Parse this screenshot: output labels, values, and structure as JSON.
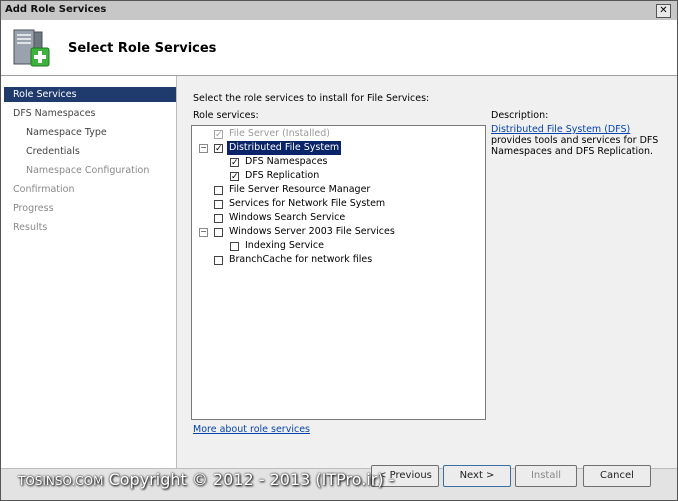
{
  "window": {
    "title": "Add Role Services",
    "close_glyph": "✕"
  },
  "header": {
    "heading": "Select Role Services",
    "icon": "server-add-icon"
  },
  "nav": {
    "items": [
      {
        "label": "Role Services",
        "state": "active"
      },
      {
        "label": "DFS Namespaces",
        "state": "normal"
      },
      {
        "label": "Namespace Type",
        "state": "sub"
      },
      {
        "label": "Credentials",
        "state": "sub"
      },
      {
        "label": "Namespace Configuration",
        "state": "sub-dim"
      },
      {
        "label": "Confirmation",
        "state": "dim"
      },
      {
        "label": "Progress",
        "state": "dim"
      },
      {
        "label": "Results",
        "state": "dim"
      }
    ]
  },
  "content": {
    "instruction": "Select the role services to install for File Services:",
    "role_services_label": "Role services:",
    "tree": [
      {
        "label": "File Server  (Installed)",
        "checked": true,
        "disabled": true
      },
      {
        "label": "Distributed File System",
        "checked": true,
        "selected": true,
        "expander": "−"
      },
      {
        "label": "DFS Namespaces",
        "checked": true
      },
      {
        "label": "DFS Replication",
        "checked": true
      },
      {
        "label": "File Server Resource Manager",
        "checked": false
      },
      {
        "label": "Services for Network File System",
        "checked": false
      },
      {
        "label": "Windows Search Service",
        "checked": false
      },
      {
        "label": "Windows Server 2003 File Services",
        "checked": false,
        "expander": "−"
      },
      {
        "label": "Indexing Service",
        "checked": false
      },
      {
        "label": "BranchCache for network files",
        "checked": false
      }
    ],
    "description_label": "Description:",
    "description_link": "Distributed File System (DFS)",
    "description_text": " provides tools and services for DFS Namespaces and DFS Replication.",
    "more_link": "More about role services"
  },
  "footer": {
    "prev_label": "< Previous",
    "next_label": "Next >",
    "install_label": "Install",
    "cancel_label": "Cancel"
  },
  "watermark": {
    "left": "TOSINSO.COM",
    "main": "Copyright © 2012 - 2013 (ITPro.ir) -"
  }
}
